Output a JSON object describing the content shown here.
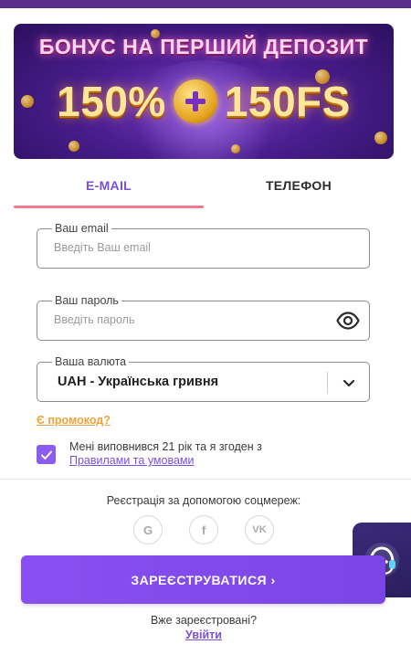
{
  "banner": {
    "headline": "БОНУС НА ПЕРШИЙ ДЕПОЗИТ",
    "offer_left": "150%",
    "offer_right": "150FS"
  },
  "tabs": [
    {
      "label": "E-MAIL",
      "active": true
    },
    {
      "label": "ТЕЛЕФОН",
      "active": false
    }
  ],
  "form": {
    "email": {
      "label": "Ваш email",
      "placeholder": "Введіть Ваш email",
      "value": ""
    },
    "password": {
      "label": "Ваш пароль",
      "placeholder": "Введіть пароль",
      "value": ""
    },
    "currency": {
      "label": "Ваша валюта",
      "value": "UAH - Українська гривня"
    },
    "promo_link": "Є промокод?",
    "agreement_text": "Мені виповнився 21 рік та я згоден з",
    "agreement_link": "Правилами та умовами",
    "agreement_checked": true
  },
  "social": {
    "title": "Реєстрація за допомогою соцмереж:",
    "buttons": [
      {
        "icon": "google-icon",
        "glyph": "G"
      },
      {
        "icon": "facebook-icon",
        "glyph": "f"
      },
      {
        "icon": "vk-icon",
        "glyph": "VK"
      }
    ]
  },
  "register_label": "ЗАРЕЄСТРУВАТИСЯ ›",
  "login": {
    "question": "Вже зареєстровані?",
    "link": "Увійти"
  },
  "colors": {
    "accent": "#7b4fd6",
    "tab_underline": "#ef7a8e",
    "promo": "#f0a23b",
    "header": "#5b2e8c"
  }
}
